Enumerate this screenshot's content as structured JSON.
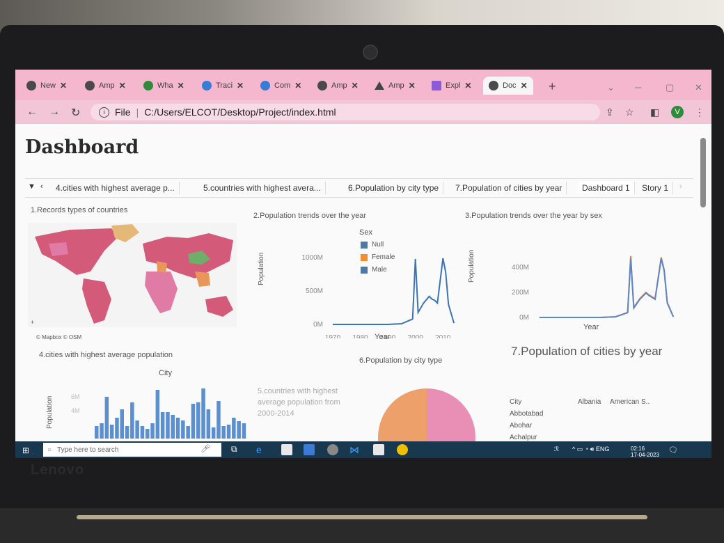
{
  "browser": {
    "tabs": [
      {
        "label": "New",
        "icon": "chrome-icon"
      },
      {
        "label": "Amp",
        "icon": "globe-icon"
      },
      {
        "label": "Wha",
        "icon": "whatsapp-icon"
      },
      {
        "label": "Traci",
        "icon": "drive-icon"
      },
      {
        "label": "Com",
        "icon": "drive-icon"
      },
      {
        "label": "Amp",
        "icon": "globe-icon"
      },
      {
        "label": "Amp",
        "icon": "triangle-icon"
      },
      {
        "label": "Expl",
        "icon": "folder-icon"
      },
      {
        "label": "Doc",
        "icon": "globe-icon"
      }
    ],
    "new_tab": "+",
    "address_scheme": "File",
    "address_url": "C:/Users/ELCOT/Desktop/Project/index.html",
    "profile_initial": "V"
  },
  "page": {
    "title": "Dashboard",
    "sheets": [
      "4.cities with highest average p...",
      "5.countries with highest avera...",
      "6.Population by city type",
      "7.Population of cities by year",
      "Dashboard 1",
      "Story 1"
    ],
    "active_sheet": "Dashboard 1"
  },
  "panels": {
    "map": {
      "caption": "1.Records types of countries",
      "attribution": "© Mapbox © OSM"
    },
    "trend": {
      "caption": "2.Population trends over the year",
      "ylabel": "Population",
      "xlabel": "Year",
      "legend_title": "Sex",
      "legend": [
        {
          "name": "Null",
          "color": "#4e79a7"
        },
        {
          "name": "Female",
          "color": "#f28e2b"
        },
        {
          "name": "Male",
          "color": "#4e79a7"
        }
      ]
    },
    "trend_sex": {
      "caption": "3.Population trends over the year by sex",
      "ylabel": "Population",
      "xlabel": "Year"
    },
    "cities": {
      "caption": "4.cities with highest average population",
      "xlabel": "City",
      "ylabel": "Population"
    },
    "countries": {
      "caption": "5.countries with highest average population from 2000-2014"
    },
    "city_type": {
      "caption": "6.Population by city type"
    },
    "cities_year": {
      "caption": "7.Population of cities by year",
      "col_header": "City",
      "countries": [
        "Albania",
        "American S.."
      ],
      "rows": [
        "Abbotabad",
        "Abohar",
        "Achalpur"
      ]
    }
  },
  "chart_data": [
    {
      "type": "line",
      "title": "2.Population trends over the year",
      "xlabel": "Year",
      "ylabel": "Population",
      "x_ticks": [
        "1970",
        "1980",
        "1990",
        "2000",
        "2010"
      ],
      "y_ticks": [
        "0M",
        "500M",
        "1000M"
      ],
      "ylim": [
        0,
        1000
      ],
      "series": [
        {
          "name": "Male",
          "color": "#3b74b2",
          "points": [
            [
              1970,
              0
            ],
            [
              1980,
              0
            ],
            [
              1990,
              0
            ],
            [
              1995,
              10
            ],
            [
              1999,
              80
            ],
            [
              2000,
              980
            ],
            [
              2001,
              180
            ],
            [
              2003,
              320
            ],
            [
              2005,
              420
            ],
            [
              2006,
              380
            ],
            [
              2007,
              360
            ],
            [
              2008,
              320
            ],
            [
              2010,
              990
            ],
            [
              2011,
              780
            ],
            [
              2012,
              300
            ],
            [
              2014,
              20
            ]
          ]
        }
      ]
    },
    {
      "type": "line",
      "title": "3.Population trends over the year by sex",
      "xlabel": "Year",
      "ylabel": "Population",
      "x_ticks": [
        "1970",
        "1980",
        "1990",
        "2000",
        "2010"
      ],
      "y_ticks": [
        "0M",
        "200M",
        "400M"
      ],
      "ylim": [
        0,
        500
      ],
      "series": [
        {
          "name": "Female",
          "color": "#e8854a",
          "points": [
            [
              1970,
              0
            ],
            [
              1980,
              0
            ],
            [
              1990,
              0
            ],
            [
              1995,
              5
            ],
            [
              1999,
              40
            ],
            [
              2000,
              490
            ],
            [
              2001,
              80
            ],
            [
              2003,
              150
            ],
            [
              2005,
              200
            ],
            [
              2006,
              180
            ],
            [
              2007,
              165
            ],
            [
              2008,
              150
            ],
            [
              2010,
              480
            ],
            [
              2011,
              380
            ],
            [
              2012,
              120
            ],
            [
              2014,
              5
            ]
          ]
        },
        {
          "name": "Male",
          "color": "#5b87c7",
          "points": [
            [
              1970,
              0
            ],
            [
              1980,
              0
            ],
            [
              1990,
              0
            ],
            [
              1995,
              5
            ],
            [
              1999,
              38
            ],
            [
              2000,
              470
            ],
            [
              2001,
              75
            ],
            [
              2003,
              145
            ],
            [
              2005,
              195
            ],
            [
              2006,
              175
            ],
            [
              2007,
              160
            ],
            [
              2008,
              145
            ],
            [
              2010,
              470
            ],
            [
              2011,
              370
            ],
            [
              2012,
              115
            ],
            [
              2014,
              5
            ]
          ]
        }
      ]
    },
    {
      "type": "bar",
      "title": "4.cities with highest average population",
      "xlabel": "City",
      "ylabel": "Population",
      "y_ticks": [
        "4M",
        "6M"
      ],
      "ylim": [
        0,
        7
      ],
      "values": [
        1.8,
        2.2,
        6.0,
        2.0,
        3.0,
        4.2,
        1.8,
        5.2,
        2.6,
        1.8,
        1.4,
        2.2,
        7.0,
        3.8,
        3.8,
        3.4,
        3.0,
        2.6,
        1.8,
        5.0,
        5.2,
        7.2,
        4.2,
        1.6,
        5.4,
        1.8,
        2.0,
        3.0,
        2.5,
        2.2
      ]
    },
    {
      "type": "pie",
      "title": "6.Population by city type",
      "slices": [
        {
          "label": "",
          "value": 50,
          "color": "#e98fb5"
        },
        {
          "label": "",
          "value": 50,
          "color": "#eda06a"
        }
      ]
    }
  ]
}
